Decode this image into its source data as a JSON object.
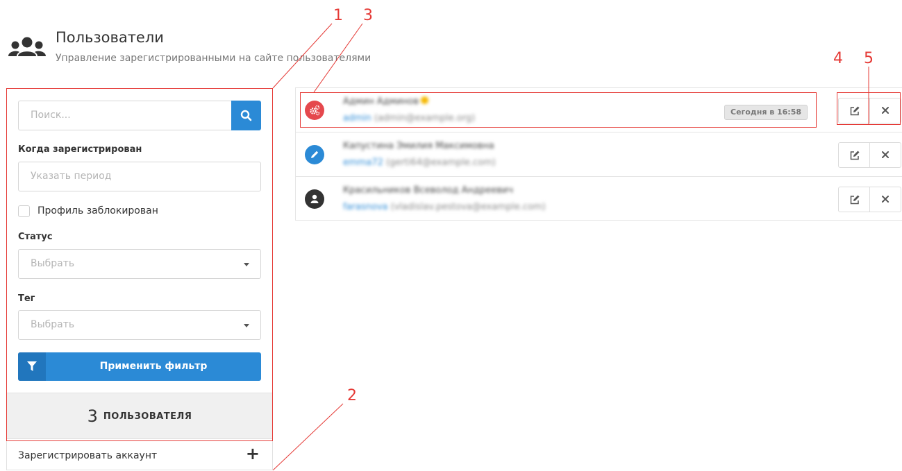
{
  "header": {
    "icon": "users-icon",
    "title": "Пользователи",
    "subtitle": "Управление зарегистрированными на сайте пользователями"
  },
  "filters": {
    "search_placeholder": "Поиск...",
    "search_icon": "search-icon",
    "registered_label": "Когда зарегистрирован",
    "period_placeholder": "Указать период",
    "blocked_label": "Профиль заблокирован",
    "blocked_checked": false,
    "status_label": "Статус",
    "status_value": "Выбрать",
    "tag_label": "Тег",
    "tag_value": "Выбрать",
    "apply_label": "Применить фильтр",
    "apply_icon": "filter-icon"
  },
  "summary": {
    "count": "3",
    "count_label": "ПОЛЬЗОВАТЕЛЯ"
  },
  "register": {
    "label": "Зарегистрировать аккаунт",
    "icon": "plus-icon",
    "plus": "+"
  },
  "users": [
    {
      "avatar_icon": "cogs-icon",
      "avatar_color": "#e5484d",
      "name": "Админ Админов",
      "login": "admin",
      "email": "(admin@example.org)",
      "last_seen": "Сегодня в 16:58"
    },
    {
      "avatar_icon": "pencil-icon",
      "avatar_color": "#2b8ad6",
      "name": "Капустина Эмилия Максимовна",
      "login": "emma72",
      "email": "(gerti64@example.com)",
      "last_seen": ""
    },
    {
      "avatar_icon": "user-icon",
      "avatar_color": "#333333",
      "name": "Красильников Всеволод Андреевич",
      "login": "farasnova",
      "email": "(vladislav.pestova@example.com)",
      "last_seen": ""
    }
  ],
  "actions": {
    "edit_icon": "edit-icon",
    "delete_icon": "close-icon"
  },
  "annotations": {
    "color": "#e53935",
    "labels": [
      "1",
      "2",
      "3",
      "4",
      "5"
    ]
  },
  "colors": {
    "accent": "#2b8ad6",
    "accent_dark": "#2176bd",
    "annotation": "#e53935"
  }
}
